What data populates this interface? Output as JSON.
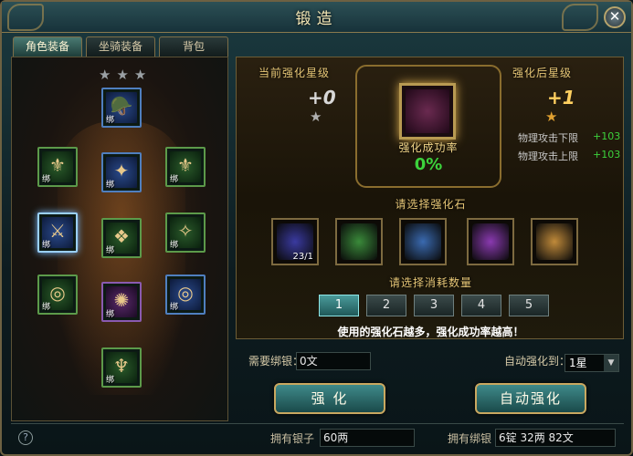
{
  "window": {
    "title": "锻造",
    "close_label": "✕"
  },
  "tabs": [
    {
      "label": "角色装备",
      "active": true
    },
    {
      "label": "坐骑装备",
      "active": false
    },
    {
      "label": "背包",
      "active": false
    }
  ],
  "equipment": {
    "stars_top": [
      "★",
      "★",
      "★"
    ],
    "bind_label": "绑",
    "slots": [
      {
        "name": "helmet",
        "quality": "blue",
        "glyph": "🪖"
      },
      {
        "name": "shoulder-left",
        "quality": "green",
        "glyph": "⚜"
      },
      {
        "name": "necklace",
        "quality": "blue",
        "glyph": "✦"
      },
      {
        "name": "shoulder-right",
        "quality": "green",
        "glyph": "⚜"
      },
      {
        "name": "weapon",
        "quality": "blue",
        "glyph": "⚔"
      },
      {
        "name": "armor",
        "quality": "green",
        "glyph": "❖"
      },
      {
        "name": "bracer",
        "quality": "green",
        "glyph": "✧"
      },
      {
        "name": "ring-left",
        "quality": "green",
        "glyph": "◎"
      },
      {
        "name": "belt",
        "quality": "purple",
        "glyph": "✺"
      },
      {
        "name": "ring-right",
        "quality": "blue",
        "glyph": "◎"
      },
      {
        "name": "boots",
        "quality": "green",
        "glyph": "♆"
      }
    ]
  },
  "enhance": {
    "current_star_label": "当前强化星级",
    "current_star_value": "+0",
    "after_star_label": "强化后星级",
    "after_star_value": "+1",
    "success_rate_label": "强化成功率",
    "success_rate_value": "0%",
    "attributes": [
      {
        "label": "物理攻击下限",
        "value": "+103"
      },
      {
        "label": "物理攻击上限",
        "value": "+103"
      }
    ],
    "select_stone_label": "请选择强化石",
    "stones": [
      {
        "name": "stone-1",
        "count": "23/1",
        "color": "#3a3aa0"
      },
      {
        "name": "stone-2",
        "count": "",
        "color": "#3a8a3a"
      },
      {
        "name": "stone-3",
        "count": "",
        "color": "#3a6ab0"
      },
      {
        "name": "stone-4",
        "count": "",
        "color": "#8a3ab0"
      },
      {
        "name": "stone-5",
        "count": "",
        "color": "#c08a3a"
      }
    ],
    "select_count_label": "请选择消耗数量",
    "counts": [
      "1",
      "2",
      "3",
      "4",
      "5"
    ],
    "hint": "使用的强化石越多，强化成功率越高！"
  },
  "footer": {
    "need_silver_label": "需要绑银：",
    "need_silver_value": "0文",
    "auto_enhance_to_label": "自动强化到：",
    "auto_enhance_to_value": "1星",
    "enhance_button": "强 化",
    "auto_enhance_button": "自动强化",
    "own_silver_label": "拥有银子",
    "own_silver_value": "60两",
    "own_bound_silver_label": "拥有绑银",
    "own_bound_silver_value": "6锭  32两  82文",
    "help_label": "?"
  },
  "colors": {
    "star_active": "#e0a030",
    "attr_value": "#3cd23c",
    "rate": "#3cd23c",
    "after_star": "#ffd060"
  }
}
